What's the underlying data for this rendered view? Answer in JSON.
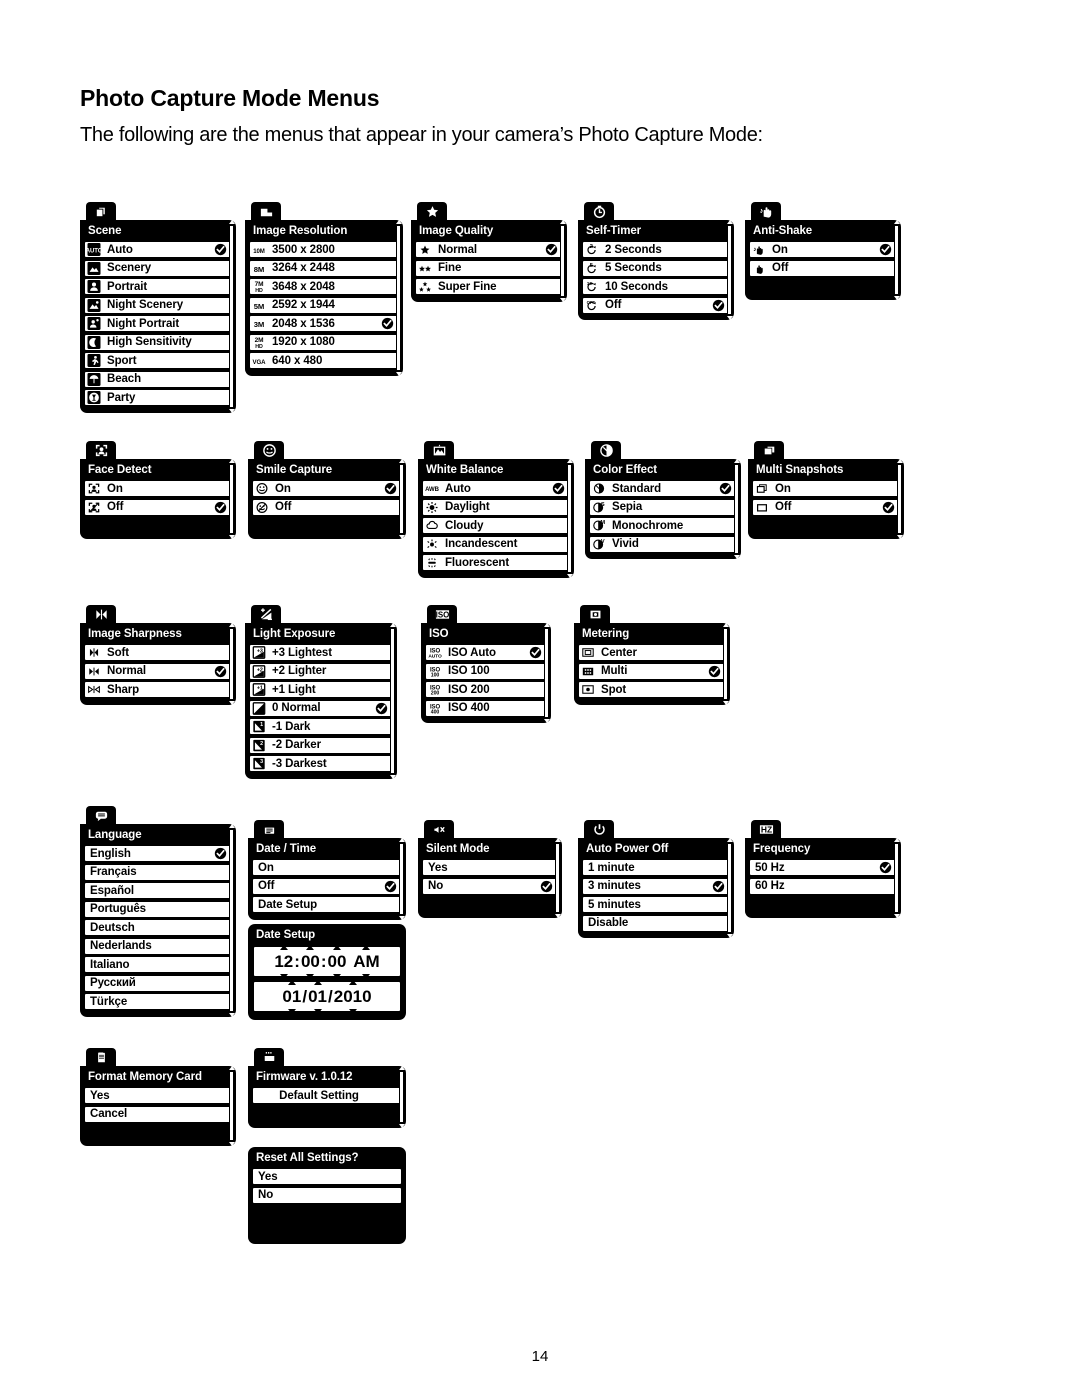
{
  "page": {
    "title": "Photo Capture Mode Menus",
    "subtitle": "The following are the menus that appear in your camera’s Photo Capture Mode:",
    "number": "14"
  },
  "menus": {
    "scene": {
      "title": "Scene",
      "tab_icon": "scene-cards-icon",
      "items": [
        {
          "icon": "auto-icon",
          "label": "Auto",
          "checked": true
        },
        {
          "icon": "scenery-icon",
          "label": "Scenery",
          "checked": false
        },
        {
          "icon": "portrait-icon",
          "label": "Portrait",
          "checked": false
        },
        {
          "icon": "night-scenery-icon",
          "label": "Night Scenery",
          "checked": false
        },
        {
          "icon": "night-portrait-icon",
          "label": "Night Portrait",
          "checked": false
        },
        {
          "icon": "high-sensitivity-icon",
          "label": "High Sensitivity",
          "checked": false
        },
        {
          "icon": "sport-icon",
          "label": "Sport",
          "checked": false
        },
        {
          "icon": "beach-icon",
          "label": "Beach",
          "checked": false
        },
        {
          "icon": "party-icon",
          "label": "Party",
          "checked": false
        }
      ]
    },
    "image_resolution": {
      "title": "Image Resolution",
      "tab_icon": "resolution-icon",
      "items": [
        {
          "icon": "10M",
          "label": "3500 x 2800",
          "checked": false
        },
        {
          "icon": "8M",
          "label": "3264 x 2448",
          "checked": false
        },
        {
          "icon": "7M-HD",
          "label": "3648 x 2048",
          "checked": false
        },
        {
          "icon": "5M",
          "label": "2592 x 1944",
          "checked": false
        },
        {
          "icon": "3M",
          "label": "2048 x 1536",
          "checked": true
        },
        {
          "icon": "2M-HD",
          "label": "1920 x 1080",
          "checked": false
        },
        {
          "icon": "VGA",
          "label": "640 x 480",
          "checked": false
        }
      ]
    },
    "image_quality": {
      "title": "Image Quality",
      "tab_icon": "star-icon",
      "items": [
        {
          "icon": "one-star-icon",
          "label": "Normal",
          "checked": true
        },
        {
          "icon": "two-star-icon",
          "label": "Fine",
          "checked": false
        },
        {
          "icon": "three-star-icon",
          "label": "Super Fine",
          "checked": false
        }
      ]
    },
    "self_timer": {
      "title": "Self-Timer",
      "tab_icon": "timer-icon",
      "items": [
        {
          "icon": "timer-2s-icon",
          "label": "2 Seconds",
          "checked": false
        },
        {
          "icon": "timer-5s-icon",
          "label": "5 Seconds",
          "checked": false
        },
        {
          "icon": "timer-10s-icon",
          "label": "10 Seconds",
          "checked": false
        },
        {
          "icon": "timer-off-icon",
          "label": "Off",
          "checked": true
        }
      ]
    },
    "anti_shake": {
      "title": "Anti-Shake",
      "tab_icon": "hand-shake-icon",
      "items": [
        {
          "icon": "hand-on-icon",
          "label": "On",
          "checked": true
        },
        {
          "icon": "hand-off-icon",
          "label": "Off",
          "checked": false
        }
      ]
    },
    "face_detect": {
      "title": "Face Detect",
      "tab_icon": "face-detect-icon",
      "items": [
        {
          "icon": "face-on-icon",
          "label": "On",
          "checked": false
        },
        {
          "icon": "face-off-icon",
          "label": "Off",
          "checked": true
        }
      ]
    },
    "smile_capture": {
      "title": "Smile Capture",
      "tab_icon": "smile-icon",
      "items": [
        {
          "icon": "smile-on-icon",
          "label": "On",
          "checked": true
        },
        {
          "icon": "smile-off-icon",
          "label": "Off",
          "checked": false
        }
      ]
    },
    "white_balance": {
      "title": "White Balance",
      "tab_icon": "white-balance-icon",
      "items": [
        {
          "icon": "awb-icon",
          "label": "Auto",
          "checked": true
        },
        {
          "icon": "daylight-icon",
          "label": "Daylight",
          "checked": false
        },
        {
          "icon": "cloudy-icon",
          "label": "Cloudy",
          "checked": false
        },
        {
          "icon": "incandescent-icon",
          "label": "Incandescent",
          "checked": false
        },
        {
          "icon": "fluorescent-icon",
          "label": "Fluorescent",
          "checked": false
        }
      ]
    },
    "color_effect": {
      "title": "Color Effect",
      "tab_icon": "color-effect-icon",
      "items": [
        {
          "icon": "standard-icon",
          "label": "Standard",
          "checked": true
        },
        {
          "icon": "sepia-icon",
          "label": "Sepia",
          "checked": false
        },
        {
          "icon": "monochrome-icon",
          "label": "Monochrome",
          "checked": false
        },
        {
          "icon": "vivid-icon",
          "label": "Vivid",
          "checked": false
        }
      ]
    },
    "multi_snapshots": {
      "title": "Multi Snapshots",
      "tab_icon": "multi-snapshot-icon",
      "items": [
        {
          "icon": "frames-on-icon",
          "label": "On",
          "checked": false
        },
        {
          "icon": "frame-off-icon",
          "label": "Off",
          "checked": true
        }
      ]
    },
    "image_sharpness": {
      "title": "Image Sharpness",
      "tab_icon": "sharpness-icon",
      "items": [
        {
          "icon": "soft-icon",
          "label": "Soft",
          "checked": false
        },
        {
          "icon": "normal-sharp-icon",
          "label": "Normal",
          "checked": true
        },
        {
          "icon": "sharp-icon",
          "label": "Sharp",
          "checked": false
        }
      ]
    },
    "light_exposure": {
      "title": "Light Exposure",
      "tab_icon": "exposure-icon",
      "items": [
        {
          "icon": "ev-plus3-icon",
          "label": "+3 Lightest",
          "checked": false
        },
        {
          "icon": "ev-plus2-icon",
          "label": "+2 Lighter",
          "checked": false
        },
        {
          "icon": "ev-plus1-icon",
          "label": "+1 Light",
          "checked": false
        },
        {
          "icon": "ev-zero-icon",
          "label": "0 Normal",
          "checked": true
        },
        {
          "icon": "ev-minus1-icon",
          "label": "-1 Dark",
          "checked": false
        },
        {
          "icon": "ev-minus2-icon",
          "label": "-2 Darker",
          "checked": false
        },
        {
          "icon": "ev-minus3-icon",
          "label": "-3 Darkest",
          "checked": false
        }
      ]
    },
    "iso": {
      "title": "ISO",
      "tab_icon": "iso-icon",
      "items": [
        {
          "icon": "iso-auto-icon",
          "label": "ISO Auto",
          "checked": true
        },
        {
          "icon": "iso-100-icon",
          "label": "ISO 100",
          "checked": false
        },
        {
          "icon": "iso-200-icon",
          "label": "ISO 200",
          "checked": false
        },
        {
          "icon": "iso-400-icon",
          "label": "ISO 400",
          "checked": false
        }
      ]
    },
    "metering": {
      "title": "Metering",
      "tab_icon": "metering-icon",
      "items": [
        {
          "icon": "center-metering-icon",
          "label": "Center",
          "checked": false
        },
        {
          "icon": "multi-metering-icon",
          "label": "Multi",
          "checked": true
        },
        {
          "icon": "spot-metering-icon",
          "label": "Spot",
          "checked": false
        }
      ]
    },
    "language": {
      "title": "Language",
      "tab_icon": "speech-bubble-icon",
      "items": [
        {
          "icon": null,
          "label": "English",
          "checked": true
        },
        {
          "icon": null,
          "label": "Français",
          "checked": false
        },
        {
          "icon": null,
          "label": "Español",
          "checked": false
        },
        {
          "icon": null,
          "label": "Português",
          "checked": false
        },
        {
          "icon": null,
          "label": "Deutsch",
          "checked": false
        },
        {
          "icon": null,
          "label": "Nederlands",
          "checked": false
        },
        {
          "icon": null,
          "label": "Italiano",
          "checked": false
        },
        {
          "icon": null,
          "label": "Русский",
          "checked": false
        },
        {
          "icon": null,
          "label": "Türkçe",
          "checked": false
        }
      ]
    },
    "date_time": {
      "title": "Date / Time",
      "tab_icon": "calendar-icon",
      "items": [
        {
          "icon": null,
          "label": "On",
          "checked": false
        },
        {
          "icon": null,
          "label": "Off",
          "checked": true
        },
        {
          "icon": null,
          "label": "Date Setup",
          "checked": false
        }
      ]
    },
    "date_setup": {
      "title": "Date Setup",
      "time": {
        "hour": "12",
        "minute": "00",
        "second": "00",
        "meridiem": "AM"
      },
      "date": {
        "month": "01",
        "day": "01",
        "year": "2010"
      }
    },
    "silent_mode": {
      "title": "Silent Mode",
      "tab_icon": "mute-icon",
      "items": [
        {
          "icon": null,
          "label": "Yes",
          "checked": false
        },
        {
          "icon": null,
          "label": "No",
          "checked": true
        }
      ]
    },
    "auto_power_off": {
      "title": "Auto Power Off",
      "tab_icon": "power-icon",
      "items": [
        {
          "icon": null,
          "label": "1 minute",
          "checked": false
        },
        {
          "icon": null,
          "label": "3 minutes",
          "checked": true
        },
        {
          "icon": null,
          "label": "5 minutes",
          "checked": false
        },
        {
          "icon": null,
          "label": "Disable",
          "checked": false
        }
      ]
    },
    "frequency": {
      "title": "Frequency",
      "tab_icon": "hz-icon",
      "items": [
        {
          "icon": null,
          "label": "50 Hz",
          "checked": true
        },
        {
          "icon": null,
          "label": "60 Hz",
          "checked": false
        }
      ]
    },
    "format_memory_card": {
      "title": "Format Memory Card",
      "tab_icon": "memory-card-icon",
      "items": [
        {
          "icon": null,
          "label": "Yes",
          "checked": false
        },
        {
          "icon": null,
          "label": "Cancel",
          "checked": false
        }
      ]
    },
    "firmware": {
      "title": "Firmware v. 1.0.12",
      "tab_icon": "firmware-icon",
      "items": [
        {
          "icon": null,
          "label": "Default Setting",
          "checked": false
        }
      ]
    },
    "reset_all": {
      "title": "Reset All Settings?",
      "tab_icon": null,
      "items": [
        {
          "icon": null,
          "label": "Yes",
          "checked": false
        },
        {
          "icon": null,
          "label": "No",
          "checked": false
        }
      ]
    }
  }
}
